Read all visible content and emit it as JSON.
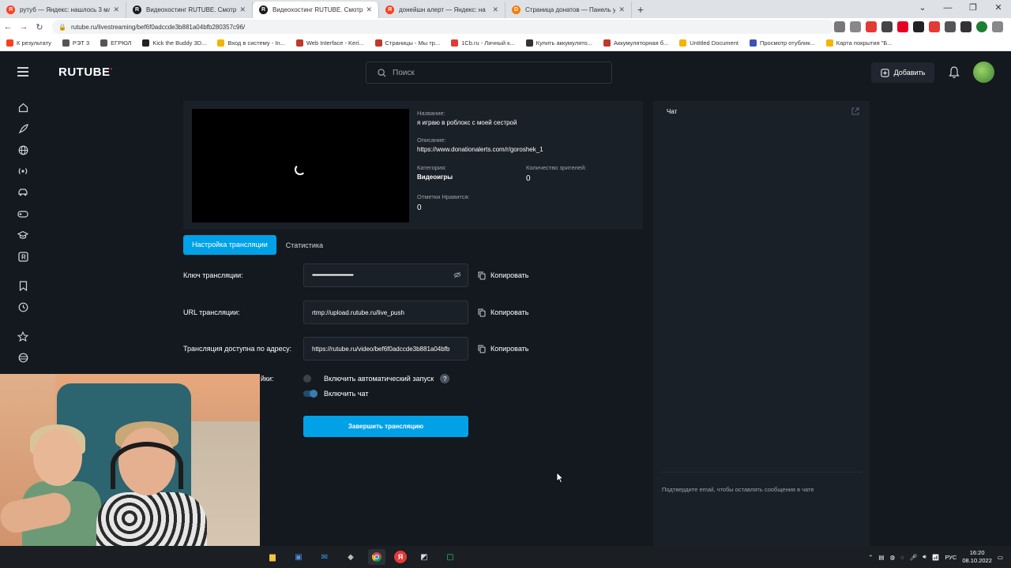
{
  "browser": {
    "tabs": [
      {
        "title": "рутуб — Яндекс: нашлось 3 млн",
        "fav_color": "#fc3f1d",
        "fav_letter": "Я",
        "active": false
      },
      {
        "title": "Видеохостинг RUTUBE. Смотри",
        "fav_color": "#1a1a1a",
        "fav_letter": "R",
        "active": false
      },
      {
        "title": "Видеохостинг RUTUBE. Смотри",
        "fav_color": "#1a1a1a",
        "fav_letter": "R",
        "active": true
      },
      {
        "title": "донейшн алерт — Яндекс: на",
        "fav_color": "#fc3f1d",
        "fav_letter": "Я",
        "active": false
      },
      {
        "title": "Страница донатов — Панель уп",
        "fav_color": "#f57c00",
        "fav_letter": "D",
        "active": false
      }
    ],
    "url": "rutube.ru/livestreaming/bef6f0adccde3b881a04bfb280357c96/",
    "bookmarks": [
      {
        "label": "К результату",
        "color": "#fc3f1d"
      },
      {
        "label": "РЭТ 3",
        "color": "#555555"
      },
      {
        "label": "ЕГРЮЛ",
        "color": "#555555"
      },
      {
        "label": "Kick the Buddy 3D...",
        "color": "#222222"
      },
      {
        "label": "Вход в систему - In...",
        "color": "#f4b400"
      },
      {
        "label": "Web Interface - Keri...",
        "color": "#c0392b"
      },
      {
        "label": "Страницы - Мы тр...",
        "color": "#c0392b"
      },
      {
        "label": "1Cb.ru - Личный к...",
        "color": "#e53935"
      },
      {
        "label": "Купить аккумулято...",
        "color": "#333333"
      },
      {
        "label": "Аккумуляторная б...",
        "color": "#c0392b"
      },
      {
        "label": "Untitled Document",
        "color": "#f4b400"
      },
      {
        "label": "Просмотр отублик...",
        "color": "#3f51b5"
      },
      {
        "label": "Карта покрытия \"Б...",
        "color": "#f4b400"
      }
    ]
  },
  "header": {
    "logo": "RUTUBE",
    "search_placeholder": "Поиск",
    "add_label": "Добавить"
  },
  "stream": {
    "title_label": "Название:",
    "title": "я играю в роблокс с моей сестрой",
    "description_label": "Описание:",
    "description": "https://www.donationalerts.com/r/goroshek_1",
    "category_label": "Категория:",
    "category": "Видеоигры",
    "viewers_label": "Количество зрителей:",
    "viewers": "0",
    "likes_label": "Отметки Нравится:",
    "likes": "0"
  },
  "tabs": {
    "settings": "Настройка трансляции",
    "stats": "Статистика"
  },
  "fields": [
    {
      "label": "Ключ трансляции:",
      "value": "••••••••••••••••••••••••••••••••••••••••••••••••••••••",
      "copy": "Копировать"
    },
    {
      "label": "URL трансляции:",
      "value": "rtmp://upload.rutube.ru/live_push",
      "copy": "Копировать"
    },
    {
      "label": "Трансляция доступна по адресу:",
      "value": "https://rutube.ru/video/bef6f0adccde3b881a04bfb",
      "copy": "Копировать"
    }
  ],
  "settings": {
    "label_partial": "йки:",
    "autostart": "Включить автоматический запуск",
    "autostart_help": "?",
    "enable_chat": "Включить чат",
    "finish_button": "Завершить трансляцию"
  },
  "chat": {
    "title": "Чат",
    "note": "Подтвердите email, чтобы оставлять сообщения в чате"
  },
  "taskbar": {
    "lang": "РУС",
    "time": "16:20",
    "date": "08.10.2022"
  },
  "colors": {
    "accent": "#00a1e7",
    "background": "#14191f",
    "panel": "#1a2028"
  }
}
